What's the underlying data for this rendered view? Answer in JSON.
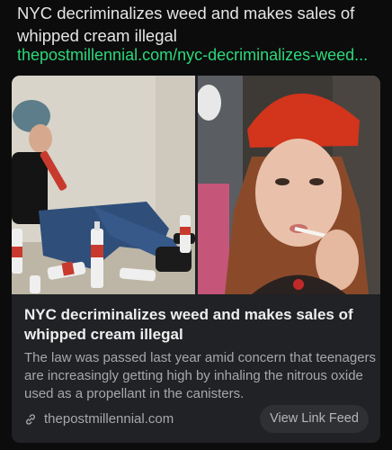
{
  "message": {
    "title": "NYC decriminalizes weed and makes sales of whipped cream illegal",
    "link": "thepostmillennial.com/nyc-decriminalizes-weed..."
  },
  "card": {
    "image_left": "whipped-cream-cans-photo",
    "image_right": "woman-smoking-photo",
    "title": "NYC decriminalizes weed and makes sales of whipped cream illegal",
    "description": "The law was passed last year amid concern that teenagers are increasingly getting high by inhaling the nitrous oxide used as a propellant in the canisters.",
    "domain_icon": "link-icon",
    "domain": "thepostmillennial.com",
    "button_label": "View Link Feed"
  },
  "colors": {
    "background": "#0c0c0d",
    "card": "#202225",
    "link": "#2bd97a",
    "muted_text": "#a6a8ab"
  }
}
